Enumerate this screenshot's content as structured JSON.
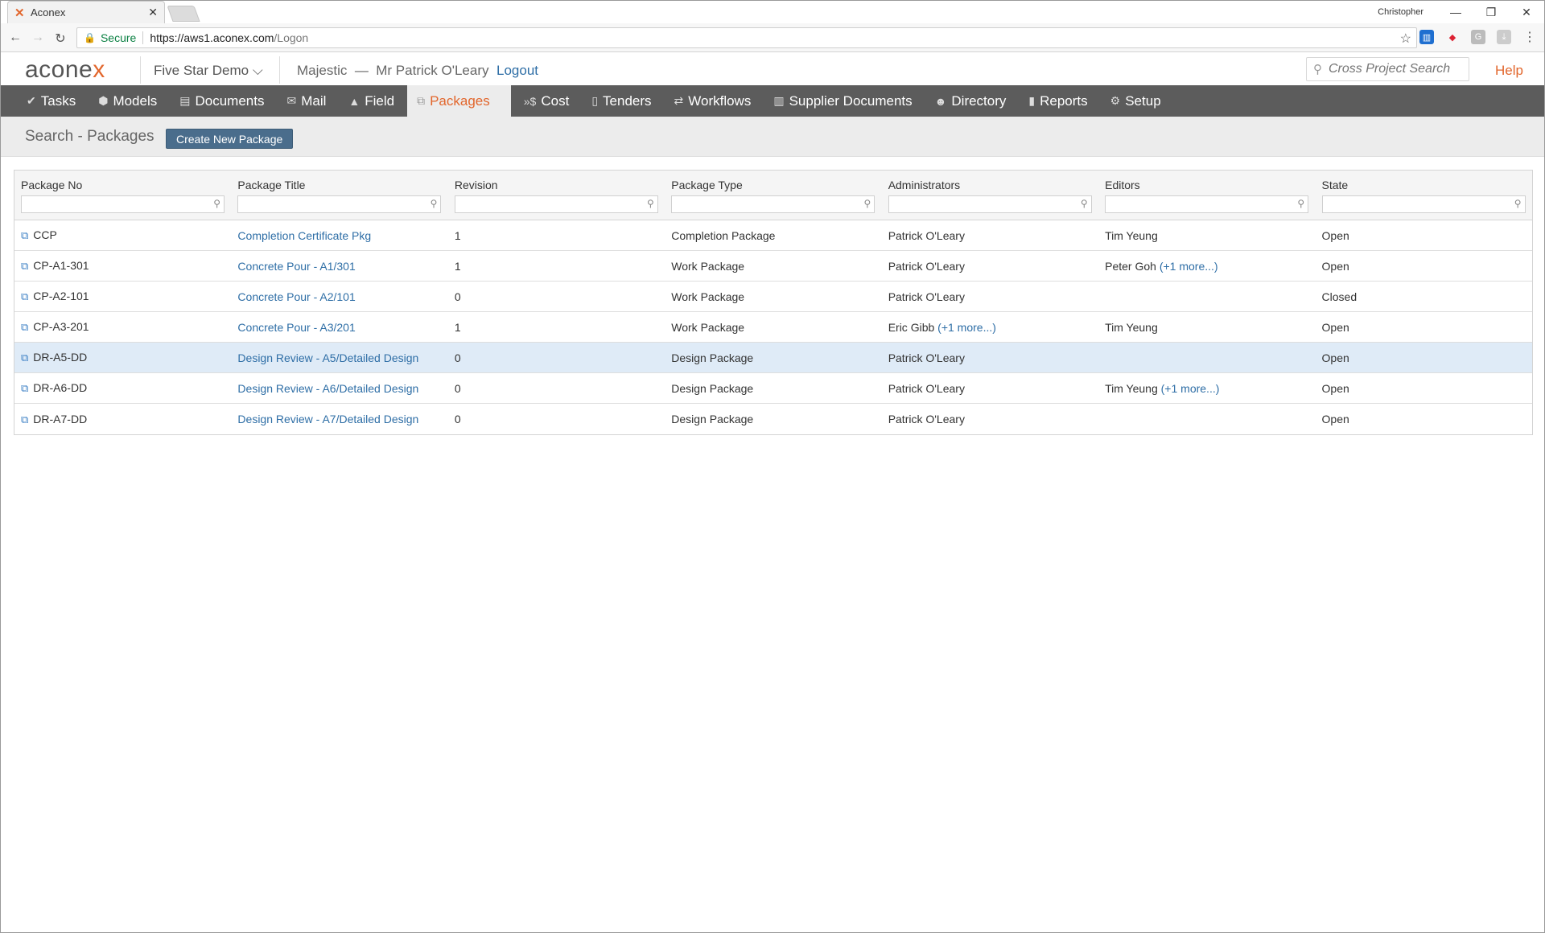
{
  "browser": {
    "tab_title": "Aconex",
    "profile": "Christopher",
    "secure_label": "Secure",
    "url_host": "https://aws1.aconex.com",
    "url_path": "/Logon"
  },
  "header": {
    "logo_text": "acone",
    "logo_accent": "x",
    "project": "Five Star Demo",
    "org": "Majestic",
    "dash": "—",
    "user": "Mr Patrick O'Leary",
    "logout": "Logout",
    "search_placeholder": "Cross Project Search",
    "help": "Help"
  },
  "nav": {
    "items": [
      {
        "label": "Tasks",
        "icon": "check-icon"
      },
      {
        "label": "Models",
        "icon": "cube-icon"
      },
      {
        "label": "Documents",
        "icon": "document-icon"
      },
      {
        "label": "Mail",
        "icon": "mail-icon"
      },
      {
        "label": "Field",
        "icon": "warning-icon"
      },
      {
        "label": "Packages",
        "icon": "packages-icon"
      },
      {
        "label": "Cost",
        "icon": "cost-icon"
      },
      {
        "label": "Tenders",
        "icon": "tenders-icon"
      },
      {
        "label": "Workflows",
        "icon": "workflow-icon"
      },
      {
        "label": "Supplier Documents",
        "icon": "supplier-icon"
      },
      {
        "label": "Directory",
        "icon": "people-icon"
      },
      {
        "label": "Reports",
        "icon": "bar-chart-icon"
      },
      {
        "label": "Setup",
        "icon": "gear-icon"
      }
    ],
    "active": "Packages"
  },
  "page": {
    "title": "Search - Packages",
    "create_button": "Create New Package"
  },
  "table": {
    "columns": [
      "Package No",
      "Package Title",
      "Revision",
      "Package Type",
      "Administrators",
      "Editors",
      "State"
    ],
    "rows": [
      {
        "no": "CCP",
        "title": "Completion Certificate Pkg",
        "rev": "1",
        "type": "Completion Package",
        "admin": "Patrick O'Leary",
        "admin_more": "",
        "editors": "Tim Yeung",
        "editors_more": "",
        "state": "Open"
      },
      {
        "no": "CP-A1-301",
        "title": "Concrete Pour - A1/301",
        "rev": "1",
        "type": "Work Package",
        "admin": "Patrick O'Leary",
        "admin_more": "",
        "editors": "Peter Goh",
        "editors_more": "(+1 more...)",
        "state": "Open"
      },
      {
        "no": "CP-A2-101",
        "title": "Concrete Pour - A2/101",
        "rev": "0",
        "type": "Work Package",
        "admin": "Patrick O'Leary",
        "admin_more": "",
        "editors": "",
        "editors_more": "",
        "state": "Closed"
      },
      {
        "no": "CP-A3-201",
        "title": "Concrete Pour - A3/201",
        "rev": "1",
        "type": "Work Package",
        "admin": "Eric Gibb",
        "admin_more": "(+1 more...)",
        "editors": "Tim Yeung",
        "editors_more": "",
        "state": "Open"
      },
      {
        "no": "DR-A5-DD",
        "title": "Design Review - A5/Detailed Design",
        "rev": "0",
        "type": "Design Package",
        "admin": "Patrick O'Leary",
        "admin_more": "",
        "editors": "",
        "editors_more": "",
        "state": "Open"
      },
      {
        "no": "DR-A6-DD",
        "title": "Design Review - A6/Detailed Design",
        "rev": "0",
        "type": "Design Package",
        "admin": "Patrick O'Leary",
        "admin_more": "",
        "editors": "Tim Yeung",
        "editors_more": "(+1 more...)",
        "state": "Open"
      },
      {
        "no": "DR-A7-DD",
        "title": "Design Review - A7/Detailed Design",
        "rev": "0",
        "type": "Design Package",
        "admin": "Patrick O'Leary",
        "admin_more": "",
        "editors": "",
        "editors_more": "",
        "state": "Open"
      }
    ],
    "selected_row": 4
  },
  "colors": {
    "accent": "#e2662c",
    "nav_bg": "#5c5c5c",
    "link": "#2e6ea6",
    "button": "#4a6d8c",
    "selected_row": "#dfebf7"
  }
}
